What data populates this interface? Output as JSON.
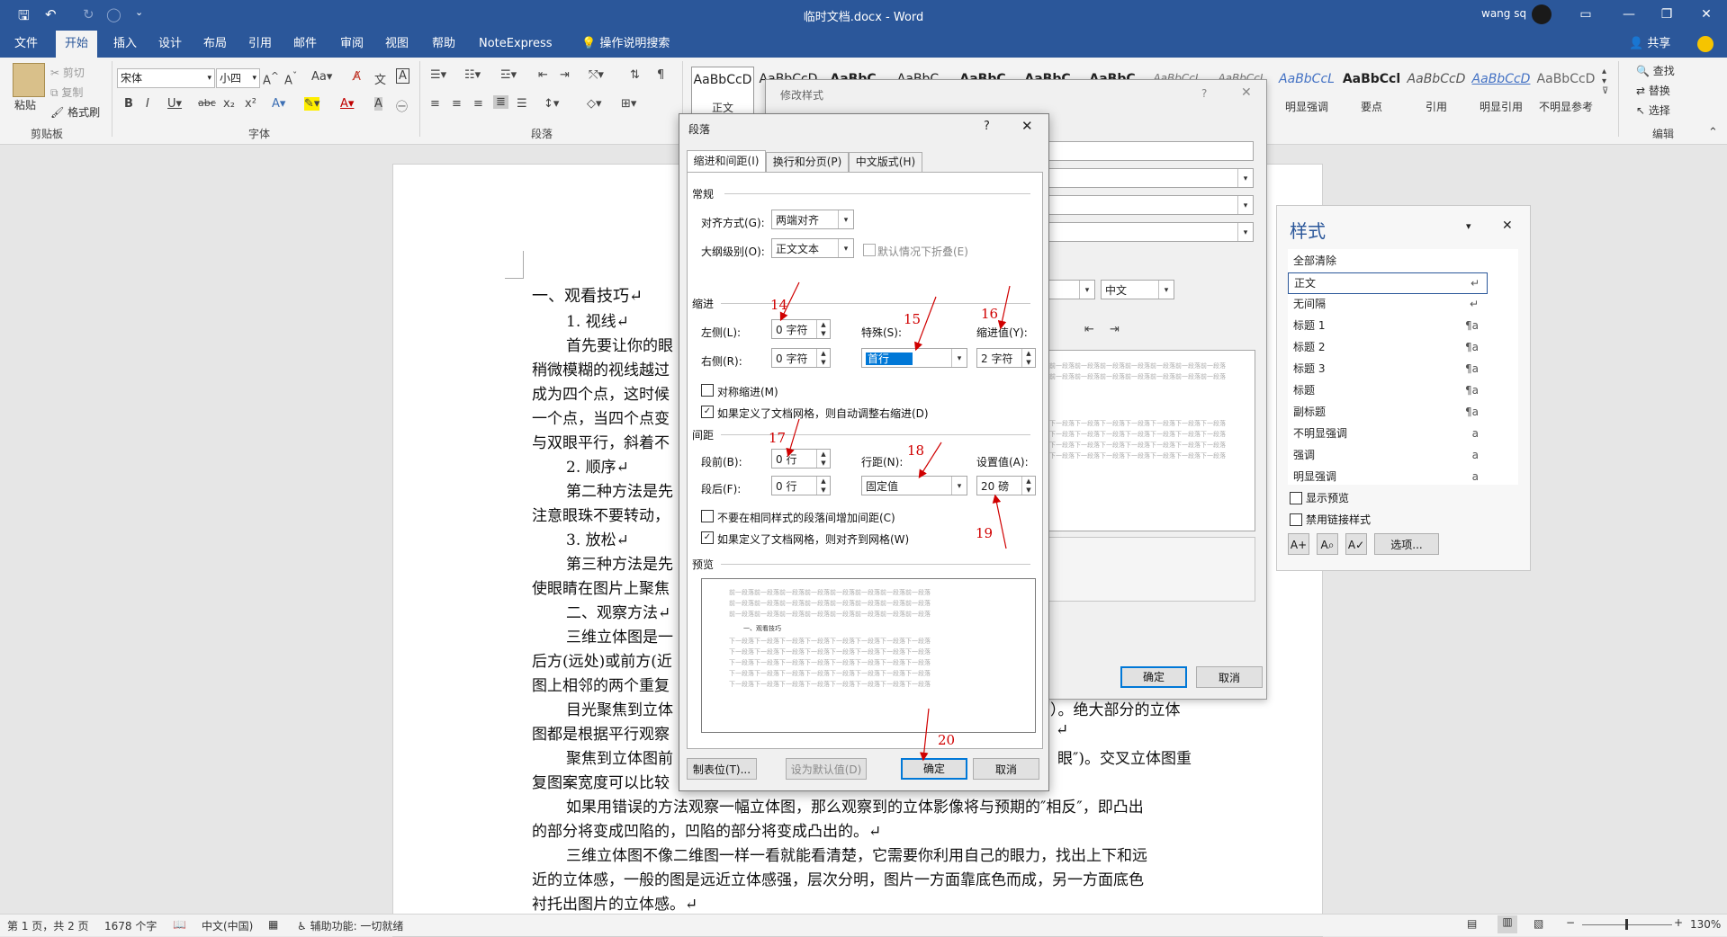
{
  "window": {
    "title": "临时文档.docx - Word",
    "user": "wang sq"
  },
  "tabs": [
    "文件",
    "开始",
    "插入",
    "设计",
    "布局",
    "引用",
    "邮件",
    "审阅",
    "视图",
    "帮助",
    "NoteExpress",
    "操作说明搜索"
  ],
  "share": "共享",
  "ribbon": {
    "paste": "粘贴",
    "cut": "剪切",
    "copy": "复制",
    "format_painter": "格式刷",
    "clipboard": "剪贴板",
    "font_name": "宋体",
    "font_size": "小四",
    "font_group": "字体",
    "para_group": "段落",
    "edit_group": "编辑",
    "find": "查找",
    "replace": "替换",
    "select": "选择",
    "styles": [
      {
        "preview": "AaBbCcD",
        "name": "正文"
      },
      {
        "preview": "AaBbCcD",
        "name": ""
      },
      {
        "preview": "AaBbC",
        "name": ""
      },
      {
        "preview": "AaBbC",
        "name": ""
      },
      {
        "preview": "AaBbC",
        "name": ""
      },
      {
        "preview": "AaBbC",
        "name": ""
      },
      {
        "preview": "AaBbC",
        "name": ""
      },
      {
        "preview": "AaBbCcL",
        "name": ""
      },
      {
        "preview": "AaBbCcL",
        "name": ""
      },
      {
        "preview": "AaBbCcL",
        "name": "明显强调"
      },
      {
        "preview": "AaBbCcl",
        "name": "要点"
      },
      {
        "preview": "AaBbCcD",
        "name": "引用"
      },
      {
        "preview": "AaBbCcD",
        "name": "明显引用"
      },
      {
        "preview": "AaBbCcD",
        "name": "不明显参考"
      }
    ]
  },
  "doc": {
    "lines": [
      "一、观看技巧↵",
      "1. 视线↵",
      "首先要让你的眼",
      "稍微模糊的视线越过",
      "成为四个点，这时候",
      "一个点，当四个点变",
      "与双眼平行，斜着不",
      "2. 顺序↵",
      "第二种方法是先",
      "注意眼珠不要转动，",
      "3. 放松↵",
      "第三种方法是先",
      "使眼睛在图片上聚焦",
      "二、观察方法↵",
      "三维立体图是一",
      "后方(远处)或前方(近",
      "图上相邻的两个重复",
      "目光聚焦到立体",
      "图都是根据平行观察",
      "聚焦到立体图前",
      "复图案宽度可以比较",
      "如果用错误的方法观察一幅立体图，那么观察到的立体影像将与预期的″相反″，即凸出",
      "的部分将变成凹陷的，凹陷的部分将变成凸出的。↵",
      "三维立体图不像二维图一样一看就能看清楚，它需要你利用自己的眼力，找出上下和远",
      "近的立体感，一般的图是远近立体感强，层次分明，图片一方面靠底色而成，另一方面底色",
      "衬托出图片的立体感。↵"
    ],
    "right_frag_1": "）。绝大部分的立体",
    "right_frag_2": "↵",
    "right_frag_3": "眼″)。交叉立体图重"
  },
  "status": {
    "page": "第 1 页，共 2 页",
    "words": "1678 个字",
    "lang": "中文(中国)",
    "access": "辅助功能: 一切就绪",
    "zoom": "130%"
  },
  "styles_pane": {
    "title": "样式",
    "items": [
      {
        "name": "全部清除",
        "mark": ""
      },
      {
        "name": "正文",
        "mark": "↵"
      },
      {
        "name": "无间隔",
        "mark": "↵"
      },
      {
        "name": "标题 1",
        "mark": "¶a"
      },
      {
        "name": "标题 2",
        "mark": "¶a"
      },
      {
        "name": "标题 3",
        "mark": "¶a"
      },
      {
        "name": "标题",
        "mark": "¶a"
      },
      {
        "name": "副标题",
        "mark": "¶a"
      },
      {
        "name": "不明显强调",
        "mark": "a"
      },
      {
        "name": "强调",
        "mark": "a"
      },
      {
        "name": "明显强调",
        "mark": "a"
      }
    ],
    "show_preview": "显示预览",
    "disable_linked": "禁用链接样式",
    "options": "选项..."
  },
  "modify_dialog": {
    "title": "修改样式",
    "lang": "中文",
    "ok": "确定",
    "cancel": "取消",
    "preview_text": "前一段落前一段落前一段落前一段落前一段落前一段落前一段落",
    "preview_text2": "下一段落下一段落下一段落下一段落下一段落下一段落下一段落"
  },
  "para_dialog": {
    "title": "段落",
    "help": "?",
    "tabs": [
      "缩进和间距(I)",
      "换行和分页(P)",
      "中文版式(H)"
    ],
    "general": "常规",
    "align_label": "对齐方式(G):",
    "align_value": "两端对齐",
    "outline_label": "大纲级别(O):",
    "outline_value": "正文文本",
    "collapse": "默认情况下折叠(E)",
    "indent": "缩进",
    "left_label": "左侧(L):",
    "left_value": "0 字符",
    "right_label": "右侧(R):",
    "right_value": "0 字符",
    "special_label": "特殊(S):",
    "special_value": "首行",
    "indent_by_label": "缩进值(Y):",
    "indent_by_value": "2 字符",
    "mirror": "对称缩进(M)",
    "auto_adjust": "如果定义了文档网格，则自动调整右缩进(D)",
    "spacing": "间距",
    "before_label": "段前(B):",
    "before_value": "0 行",
    "after_label": "段后(F):",
    "after_value": "0 行",
    "line_label": "行距(N):",
    "line_value": "固定值",
    "at_label": "设置值(A):",
    "at_value": "20 磅",
    "no_space": "不要在相同样式的段落间增加间距(C)",
    "snap_grid": "如果定义了文档网格，则对齐到网格(W)",
    "preview": "预览",
    "preview_sample": "一、观看技巧",
    "preview_prev": "前一段落前一段落前一段落前一段落前一段落前一段落前一段落前一段落",
    "preview_next": "下一段落下一段落下一段落下一段落下一段落下一段落下一段落下一段落",
    "tabs_btn": "制表位(T)...",
    "default_btn": "设为默认值(D)",
    "ok": "确定",
    "cancel": "取消"
  },
  "annotations": [
    "14",
    "15",
    "16",
    "17",
    "18",
    "19",
    "20"
  ]
}
